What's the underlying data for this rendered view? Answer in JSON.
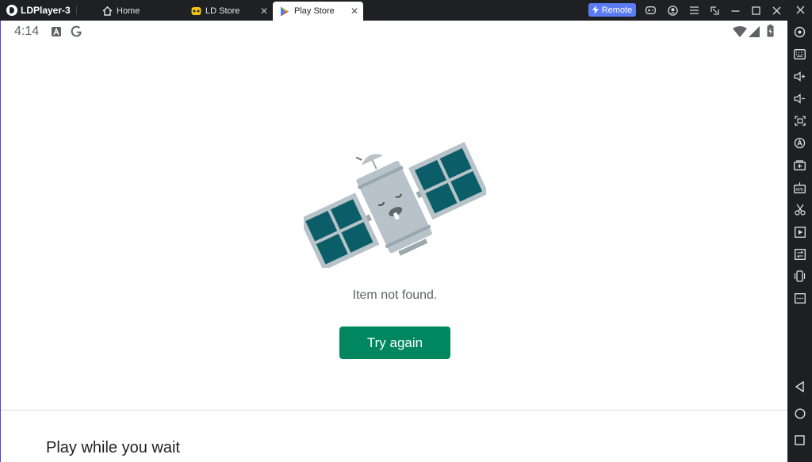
{
  "app": {
    "name": "LDPlayer-3"
  },
  "tabs": [
    {
      "label": "Home",
      "icon": "home-icon",
      "closable": false
    },
    {
      "label": "LD Store",
      "icon": "ld-store-icon",
      "closable": true
    },
    {
      "label": "Play Store",
      "icon": "play-store-icon",
      "closable": true,
      "active": true
    }
  ],
  "titlebar": {
    "remote_label": "Remote",
    "icons": [
      "gamepad-icon",
      "account-icon",
      "menu-icon",
      "resize-icon",
      "minimize-icon",
      "maximize-icon",
      "close-icon",
      "collapse-sidebar-icon"
    ]
  },
  "statusbar": {
    "time": "4:14",
    "icons": [
      "a-notification-icon",
      "google-icon",
      "wifi-icon",
      "signal-icon",
      "battery-icon"
    ]
  },
  "error": {
    "illustration": "satellite-illustration",
    "message": "Item not found.",
    "retry_label": "Try again"
  },
  "section": {
    "title": "Play while you wait"
  },
  "sidebar": {
    "tools": [
      "settings-icon",
      "keyboard-icon",
      "volume-up-icon",
      "volume-down-icon",
      "screenshot-icon",
      "auto-click-icon",
      "add-screen-icon",
      "apk-install-icon",
      "scissors-icon",
      "record-icon",
      "sync-icon",
      "shake-icon",
      "more-icon"
    ],
    "nav": [
      "back-icon",
      "home-nav-icon",
      "recent-apps-icon"
    ]
  },
  "colors": {
    "accent_green": "#01875f",
    "remote_blue": "#5b7cf5",
    "satellite_teal": "#0b5e68",
    "satellite_gray": "#b7c3c8"
  }
}
